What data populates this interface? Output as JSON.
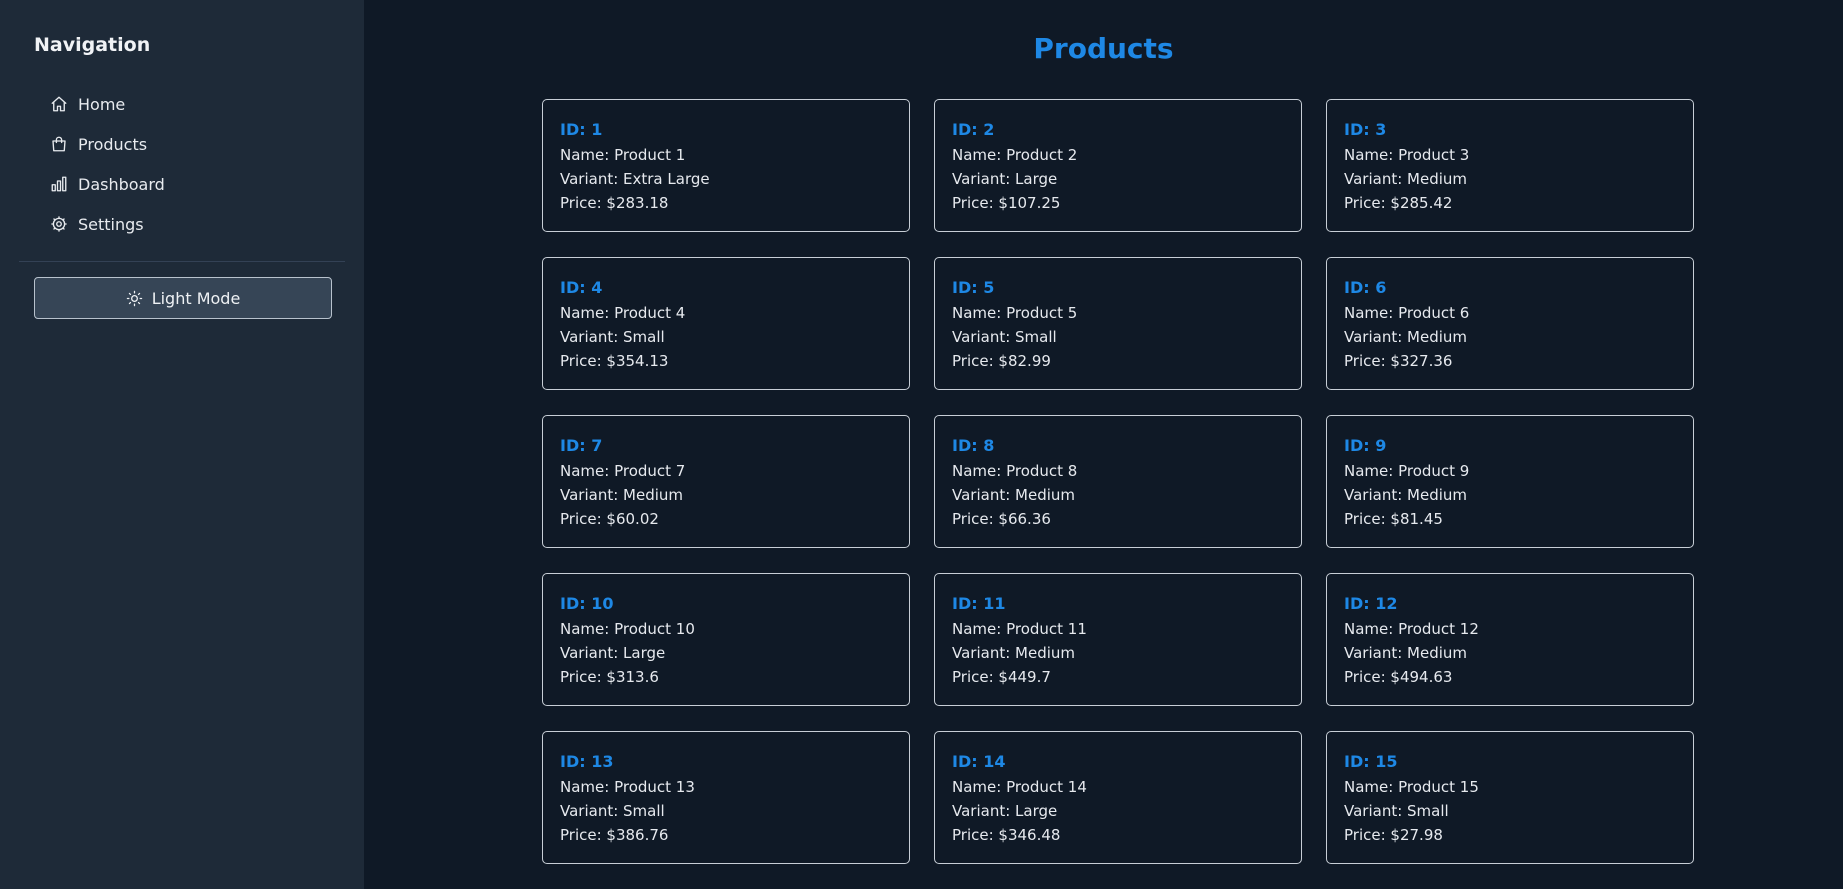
{
  "sidebar": {
    "title": "Navigation",
    "items": [
      {
        "label": "Home",
        "icon": "home-icon"
      },
      {
        "label": "Products",
        "icon": "bag-icon"
      },
      {
        "label": "Dashboard",
        "icon": "bar-chart-icon"
      },
      {
        "label": "Settings",
        "icon": "gear-icon"
      }
    ],
    "theme_button": {
      "label": "Light Mode",
      "icon": "sun-icon"
    }
  },
  "main": {
    "title": "Products",
    "labels": {
      "id": "ID: ",
      "name": "Name: ",
      "variant": "Variant: ",
      "price": "Price: $"
    },
    "products": [
      {
        "id": "1",
        "name": "Product 1",
        "variant": "Extra Large",
        "price": "283.18"
      },
      {
        "id": "2",
        "name": "Product 2",
        "variant": "Large",
        "price": "107.25"
      },
      {
        "id": "3",
        "name": "Product 3",
        "variant": "Medium",
        "price": "285.42"
      },
      {
        "id": "4",
        "name": "Product 4",
        "variant": "Small",
        "price": "354.13"
      },
      {
        "id": "5",
        "name": "Product 5",
        "variant": "Small",
        "price": "82.99"
      },
      {
        "id": "6",
        "name": "Product 6",
        "variant": "Medium",
        "price": "327.36"
      },
      {
        "id": "7",
        "name": "Product 7",
        "variant": "Medium",
        "price": "60.02"
      },
      {
        "id": "8",
        "name": "Product 8",
        "variant": "Medium",
        "price": "66.36"
      },
      {
        "id": "9",
        "name": "Product 9",
        "variant": "Medium",
        "price": "81.45"
      },
      {
        "id": "10",
        "name": "Product 10",
        "variant": "Large",
        "price": "313.6"
      },
      {
        "id": "11",
        "name": "Product 11",
        "variant": "Medium",
        "price": "449.7"
      },
      {
        "id": "12",
        "name": "Product 12",
        "variant": "Medium",
        "price": "494.63"
      },
      {
        "id": "13",
        "name": "Product 13",
        "variant": "Small",
        "price": "386.76"
      },
      {
        "id": "14",
        "name": "Product 14",
        "variant": "Large",
        "price": "346.48"
      },
      {
        "id": "15",
        "name": "Product 15",
        "variant": "Small",
        "price": "27.98"
      }
    ]
  },
  "colors": {
    "accent": "#1e88e5",
    "sidebar_bg": "#1e2a38",
    "page_bg": "#0f1926",
    "card_border": "#c7ced6"
  }
}
